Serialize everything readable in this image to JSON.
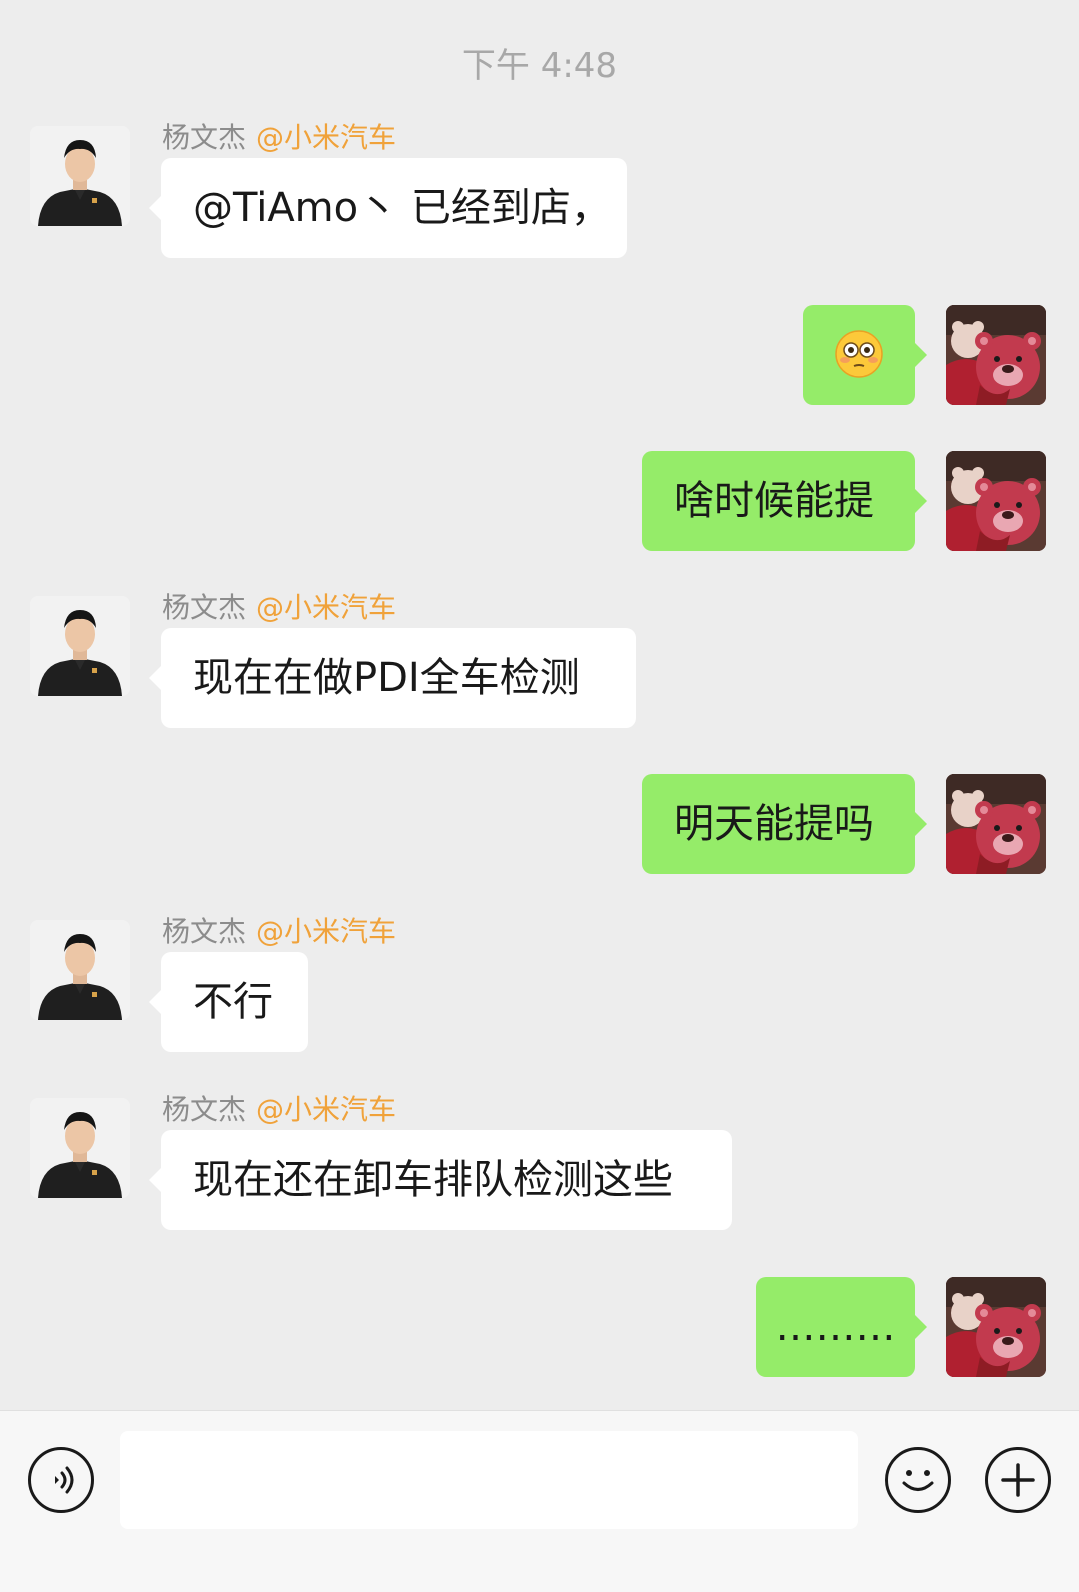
{
  "header": {
    "timestamp": "下午 4:48"
  },
  "messages": [
    {
      "direction": "incoming",
      "sender": "杨文杰",
      "tag": "@小米汽车",
      "text": "@TiAmo丶 已经到店，"
    },
    {
      "direction": "outgoing",
      "emoji": "flushed-face-emoji"
    },
    {
      "direction": "outgoing",
      "text": "啥时候能提"
    },
    {
      "direction": "incoming",
      "sender": "杨文杰",
      "tag": "@小米汽车",
      "text": "现在在做PDI全车检测"
    },
    {
      "direction": "outgoing",
      "text": "明天能提吗"
    },
    {
      "direction": "incoming",
      "sender": "杨文杰",
      "tag": "@小米汽车",
      "text": "不行"
    },
    {
      "direction": "incoming",
      "sender": "杨文杰",
      "tag": "@小米汽车",
      "text": "现在还在卸车排队检测这些"
    },
    {
      "direction": "outgoing",
      "text": "………"
    }
  ],
  "input_bar": {
    "voice_icon": "voice-icon",
    "input_value": "",
    "emoji_icon": "emoji-smile-icon",
    "plus_icon": "plus-icon"
  },
  "colors": {
    "background": "#ededed",
    "incoming_bubble": "#ffffff",
    "outgoing_bubble": "#95ec69",
    "tag": "#f0a23a",
    "sender": "#8c8c8c"
  }
}
